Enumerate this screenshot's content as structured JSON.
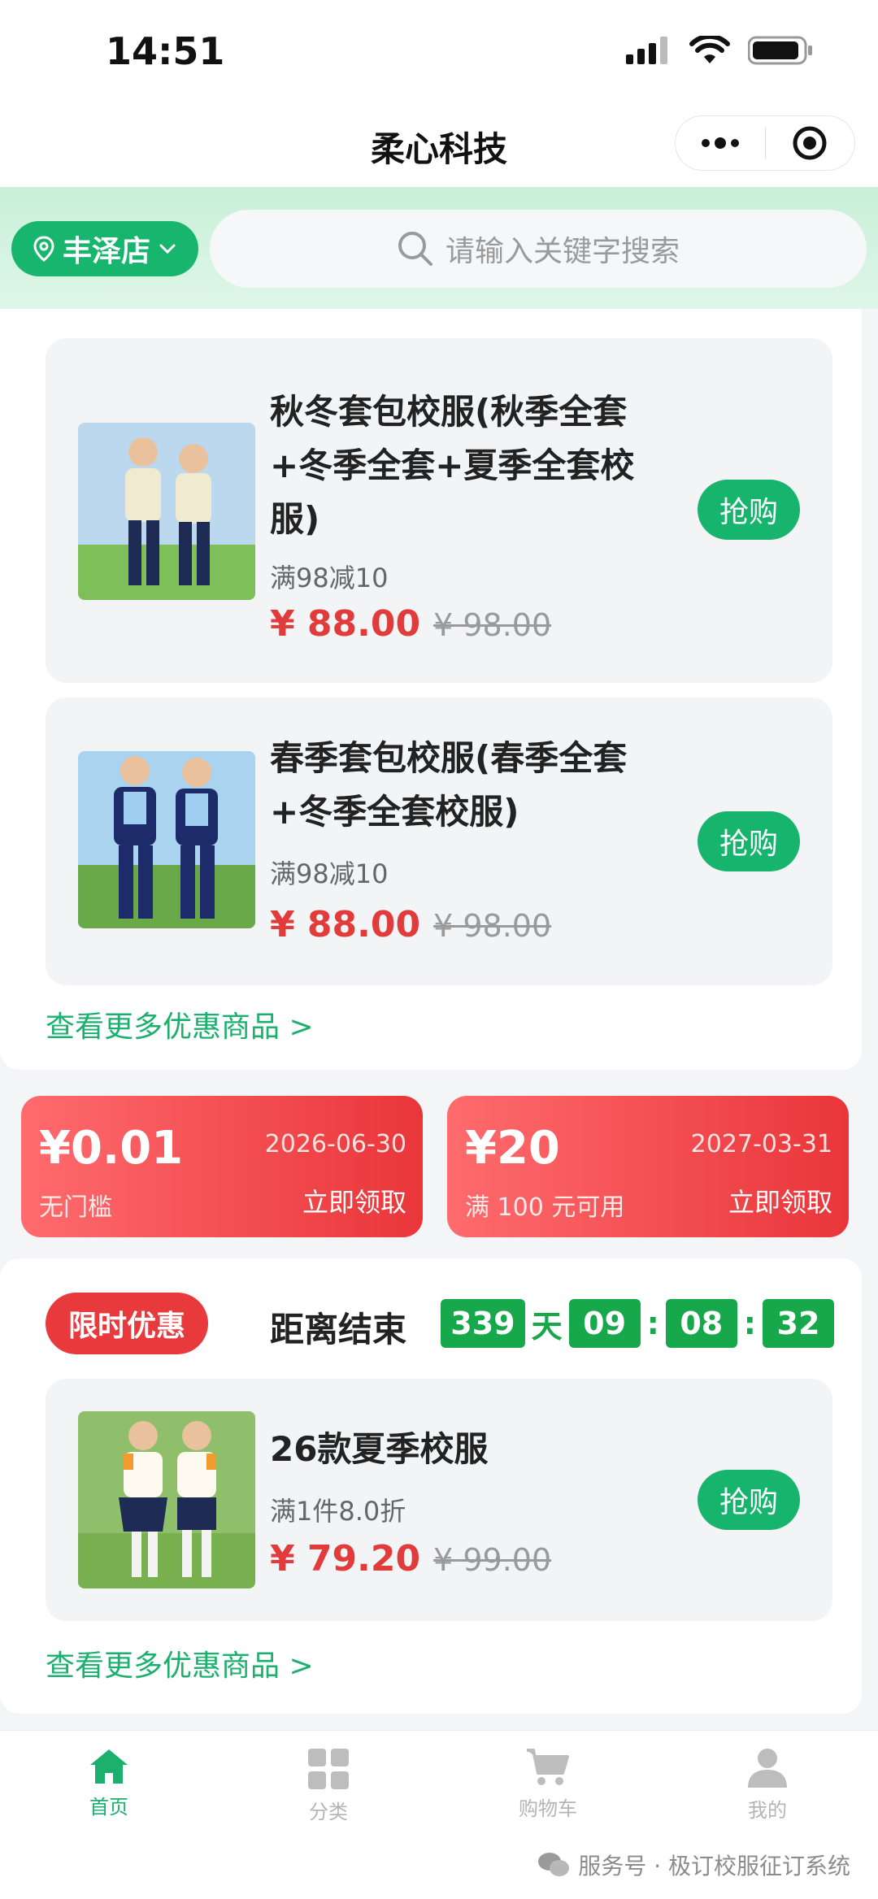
{
  "status_bar": {
    "time": "14:51"
  },
  "nav": {
    "title": "柔心科技"
  },
  "header": {
    "store_name": "丰泽店",
    "search_placeholder": "请输入关键字搜索"
  },
  "discount_products": [
    {
      "name": "秋冬套包校服(秋季全套+冬季全套+夏季全套校服)",
      "promo": "满98减10",
      "price": "¥ 88.00",
      "original_price": "¥ 98.00",
      "buy_label": "抢购"
    },
    {
      "name": "春季套包校服(春季全套+冬季全套校服)",
      "promo": "满98减10",
      "price": "¥ 88.00",
      "original_price": "¥ 98.00",
      "buy_label": "抢购"
    }
  ],
  "more_link_1": "查看更多优惠商品 >",
  "coupons": [
    {
      "amount": "¥0.01",
      "expiry": "2026-06-30",
      "condition": "无门槛",
      "claim": "立即领取"
    },
    {
      "amount": "¥20",
      "expiry": "2027-03-31",
      "condition": "满 100 元可用",
      "claim": "立即领取"
    }
  ],
  "flash_sale": {
    "badge": "限时优惠",
    "countdown_label": "距离结束",
    "days": "339",
    "day_unit": "天",
    "hours": "09",
    "minutes": "08",
    "seconds": "32",
    "product": {
      "name": "26款夏季校服",
      "promo": "满1件8.0折",
      "price": "¥ 79.20",
      "original_price": "¥ 99.00",
      "buy_label": "抢购"
    },
    "more_link": "查看更多优惠商品 >"
  },
  "tabs": [
    {
      "label": "首页",
      "icon": "home-icon",
      "active": true
    },
    {
      "label": "分类",
      "icon": "category-icon",
      "active": false
    },
    {
      "label": "购物车",
      "icon": "cart-icon",
      "active": false
    },
    {
      "label": "我的",
      "icon": "user-icon",
      "active": false
    }
  ],
  "watermark": "服务号 · 极订校服征订系统",
  "colors": {
    "accent": "#18b56f",
    "price": "#e23b3b",
    "coupon": "#e9363a",
    "countdown": "#17a84c"
  }
}
